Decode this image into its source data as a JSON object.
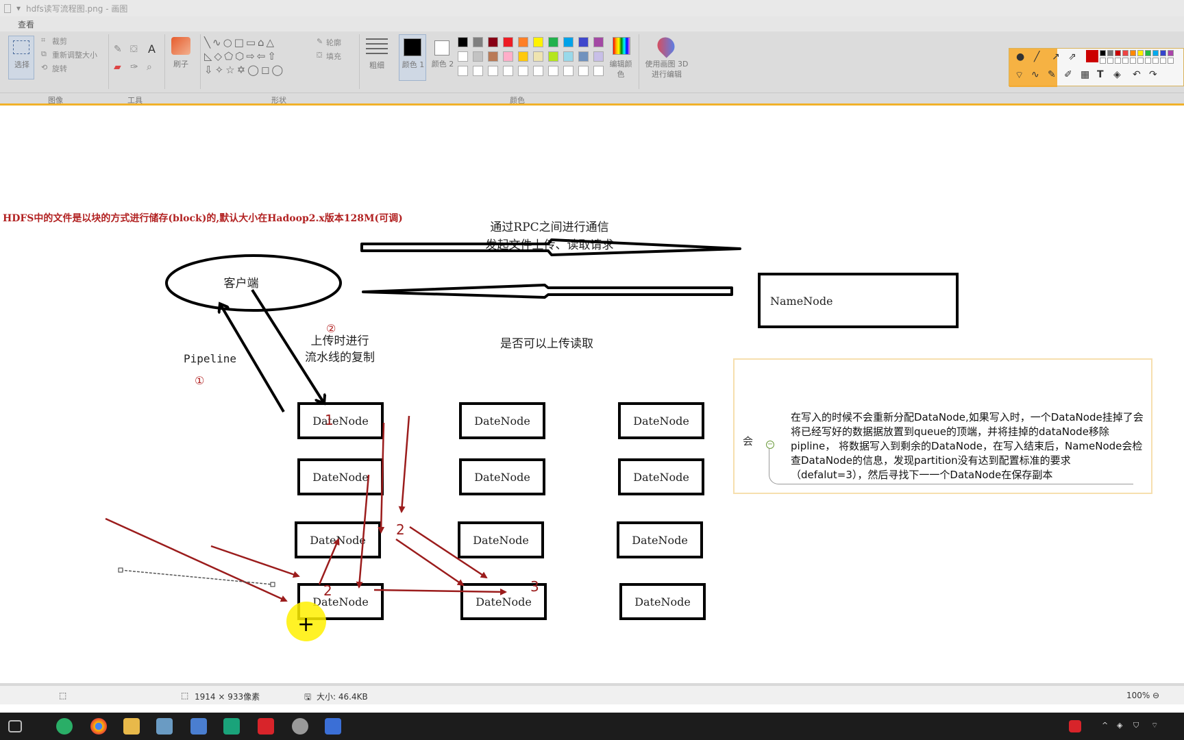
{
  "window": {
    "title": "hdfs读写流程图.png - 画图"
  },
  "menu": {
    "view": "查看"
  },
  "ribbon": {
    "select": "选择",
    "crop": "裁剪",
    "resize": "重新调整大小",
    "rotate": "旋转",
    "brush": "刷子",
    "outline": "轮廓",
    "fill": "填充",
    "size": "粗细",
    "color1": "颜色 1",
    "color2": "颜色 2",
    "edit_colors": "编辑颜色",
    "paint3d": "使用画图 3D 进行编辑",
    "groups": {
      "image": "图像",
      "tools": "工具",
      "shapes": "形状",
      "colors": "颜色"
    },
    "palette": [
      "#000000",
      "#7f7f7f",
      "#880015",
      "#ed1c24",
      "#ff7f27",
      "#fff200",
      "#22b14c",
      "#00a2e8",
      "#3f48cc",
      "#a349a4",
      "#ffffff",
      "#c3c3c3",
      "#b97a57",
      "#ffaec9",
      "#ffc90e",
      "#efe4b0",
      "#b5e61d",
      "#99d9ea",
      "#7092be",
      "#c8bfe7"
    ]
  },
  "diagram": {
    "heading": "HDFS中的文件是以块的方式进行储存(block)的,默认大小在Hadoop2.x版本128M(可调)",
    "client": "客户端",
    "namenode": "NameNode",
    "rpc_line1": "通过RPC之间进行通信",
    "rpc_line2": "发起文件上传、读取请求",
    "reply": "是否可以上传读取",
    "pipeline": "Pipeline",
    "circle1": "①",
    "circle2": "②",
    "upload_line1": "上传时进行",
    "upload_line2": "流水线的复制",
    "datanode": "DateNode",
    "num1": "1",
    "num2a": "2",
    "num2b": "2",
    "num3": "3",
    "note_side": "会",
    "note_text": "在写入的时候不会重新分配DataNode,如果写入时，一个DataNode挂掉了会将已经写好的数据据放置到queue的顶端，并将挂掉的dataNode移除pipline， 将数据写入到剩余的DataNode，在写入结束后，NameNode会检查DataNode的信息，发现partition没有达到配置标准的要求（defalut=3），然后寻找下一一个DataNode在保存副本"
  },
  "status": {
    "dimensions": "1914 × 933像素",
    "filesize": "大小: 46.4KB",
    "zoom": "100%"
  }
}
